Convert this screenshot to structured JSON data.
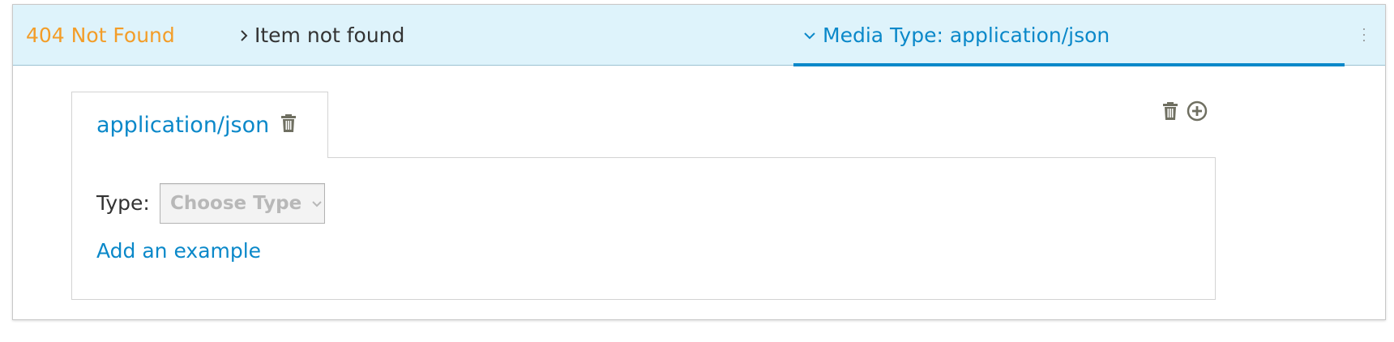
{
  "response": {
    "status_text": "404 Not Found",
    "description": "Item not found",
    "status_color": "#f39d28"
  },
  "media_type_toggle": {
    "label": "Media Type: application/json",
    "expanded": true,
    "icon": "chevron-down-icon",
    "accent_color": "#0a88c9"
  },
  "header_actions": {
    "kebab_icon": "kebab-menu-icon"
  },
  "media_tabs": [
    {
      "label": "application/json",
      "active": true,
      "icon": "trash-icon"
    }
  ],
  "body_form": {
    "type_label": "Type:",
    "type_select": {
      "placeholder": "Choose Type",
      "icon": "chevron-down-icon"
    },
    "add_example_label": "Add an example"
  },
  "tab_actions": {
    "delete_icon": "trash-icon",
    "add_icon": "plus-circle-icon"
  }
}
